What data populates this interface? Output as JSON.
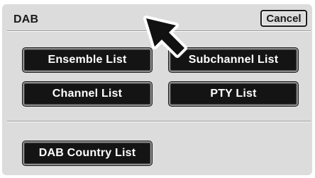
{
  "header": {
    "title": "DAB",
    "cancel_label": "Cancel"
  },
  "menu": {
    "items": [
      {
        "label": "Ensemble List"
      },
      {
        "label": "Subchannel List"
      },
      {
        "label": "Channel List"
      },
      {
        "label": "PTY List"
      }
    ],
    "country_label": "DAB Country List"
  },
  "pointer": {
    "icon": "pointer-arrow-icon",
    "color": "#111111"
  }
}
